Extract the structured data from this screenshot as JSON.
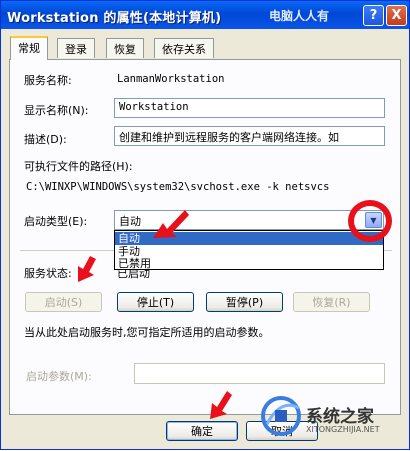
{
  "window": {
    "title": "Workstation 的属性(本地计算机)",
    "watermark": "电脑人人有",
    "help_label": "?",
    "close_label": "X"
  },
  "tabs": [
    {
      "label": "常规",
      "active": true
    },
    {
      "label": "登录",
      "active": false
    },
    {
      "label": "恢复",
      "active": false
    },
    {
      "label": "依存关系",
      "active": false
    }
  ],
  "general": {
    "service_name_label": "服务名称:",
    "service_name_value": "LanmanWorkstation",
    "display_name_label": "显示名称(N):",
    "display_name_value": "Workstation",
    "description_label": "描述(D):",
    "description_value": "创建和维护到远程服务的客户端网络连接。如",
    "exe_path_label": "可执行文件的路径(H):",
    "exe_path_value": "C:\\WINXP\\WINDOWS\\system32\\svchost.exe -k netsvcs",
    "startup_type_label": "启动类型(E):",
    "startup_type_value": "自动",
    "startup_options": [
      "自动",
      "手动",
      "已禁用"
    ],
    "service_status_label": "服务状态:",
    "service_status_value": "已启动",
    "buttons": {
      "start": "启动(S)",
      "stop": "停止(T)",
      "pause": "暂停(P)",
      "resume": "恢复(R)"
    },
    "hint": "当从此处启动服务时,您可指定所适用的启动参数。",
    "start_params_label": "启动参数(M):",
    "start_params_value": ""
  },
  "footer": {
    "ok": "确定",
    "cancel": "取消"
  },
  "logo": {
    "text": "系统之家",
    "url": "XITONGZHIJIA.NET"
  },
  "colors": {
    "titlebar": "#0a55e8",
    "annotation_red": "#e8101a",
    "selection": "#316ac5"
  }
}
